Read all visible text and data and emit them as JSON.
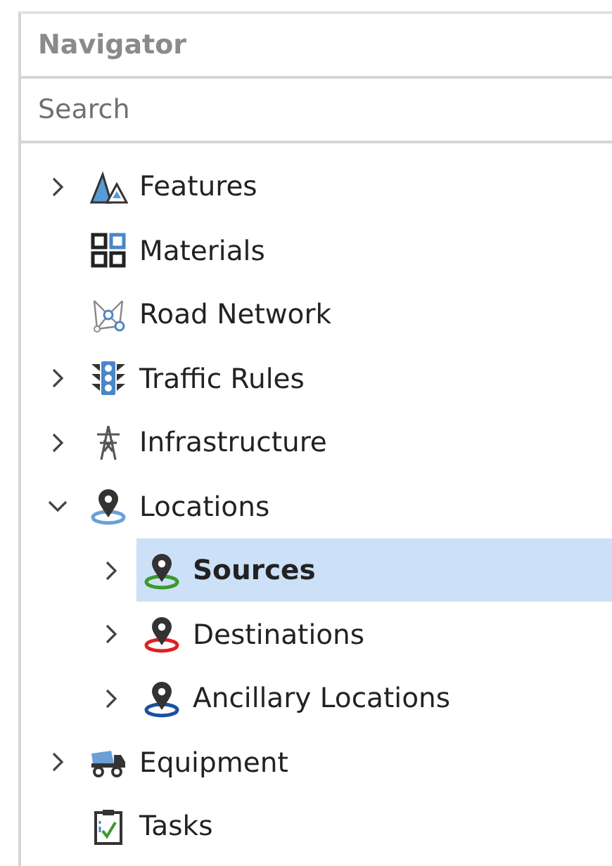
{
  "navigator": {
    "title": "Navigator",
    "search": {
      "placeholder": "Search"
    },
    "tree": [
      {
        "label": "Features",
        "kind": "mountains",
        "expandable": true,
        "expanded": false,
        "selected": false
      },
      {
        "label": "Materials",
        "kind": "grid",
        "expandable": false,
        "expanded": false,
        "selected": false
      },
      {
        "label": "Road Network",
        "kind": "network",
        "expandable": false,
        "expanded": false,
        "selected": false
      },
      {
        "label": "Traffic Rules",
        "kind": "traffic",
        "expandable": true,
        "expanded": false,
        "selected": false
      },
      {
        "label": "Infrastructure",
        "kind": "tower",
        "expandable": true,
        "expanded": false,
        "selected": false
      },
      {
        "label": "Locations",
        "kind": "pin",
        "color": "#6a9fd8",
        "expandable": true,
        "expanded": true,
        "selected": false,
        "children": [
          {
            "label": "Sources",
            "kind": "pin",
            "color": "#3a9a2a",
            "expandable": true,
            "expanded": false,
            "selected": true
          },
          {
            "label": "Destinations",
            "kind": "pin",
            "color": "#e02020",
            "expandable": true,
            "expanded": false,
            "selected": false
          },
          {
            "label": "Ancillary Locations",
            "kind": "pin",
            "color": "#1a4fa0",
            "expandable": true,
            "expanded": false,
            "selected": false
          }
        ]
      },
      {
        "label": "Equipment",
        "kind": "truck",
        "expandable": true,
        "expanded": false,
        "selected": false
      },
      {
        "label": "Tasks",
        "kind": "clipboard",
        "expandable": false,
        "expanded": false,
        "selected": false
      }
    ]
  }
}
